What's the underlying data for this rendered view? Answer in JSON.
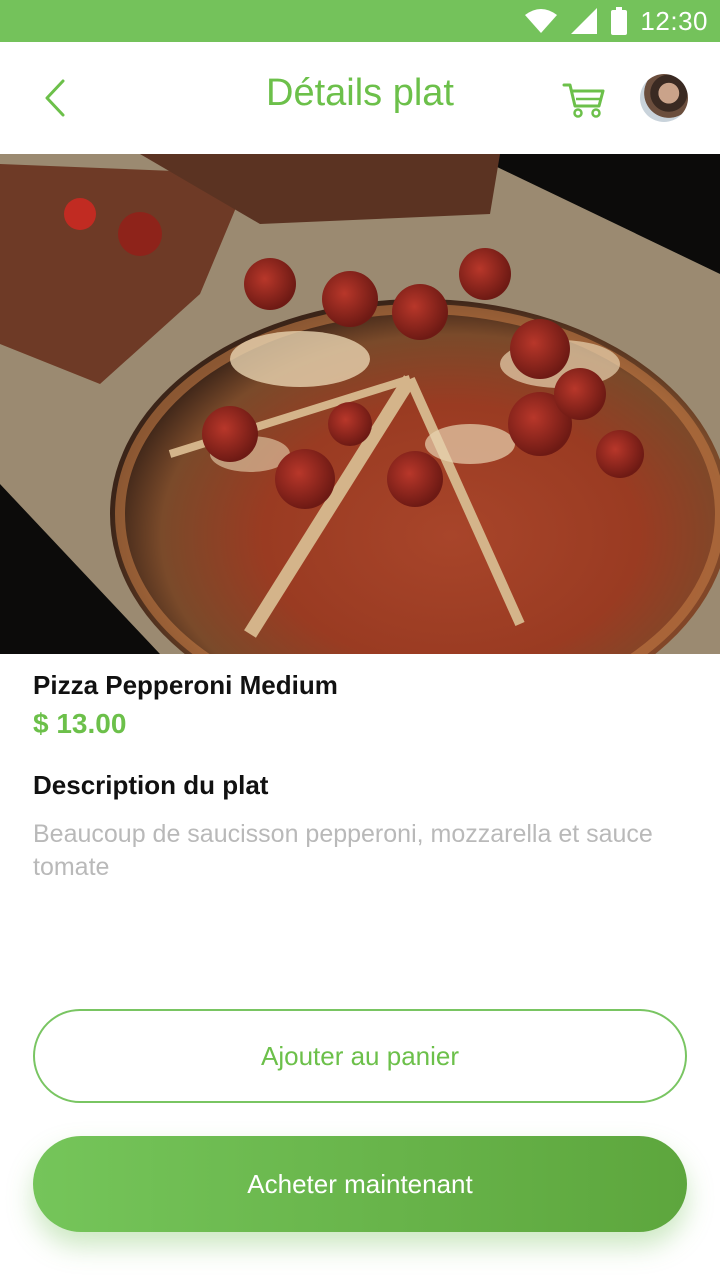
{
  "status_bar": {
    "time": "12:30"
  },
  "header": {
    "title": "Détails plat"
  },
  "product": {
    "name": "Pizza Pepperoni Medium",
    "price": "$ 13.00",
    "description_title": "Description du plat",
    "description": "Beaucoup de saucisson pepperoni, mozzarella et sauce tomate"
  },
  "actions": {
    "add_to_cart": "Ajouter au panier",
    "buy_now": "Acheter maintenant"
  },
  "icons": {
    "back": "chevron-left-icon",
    "cart": "shopping-cart-icon",
    "wifi": "wifi-icon",
    "signal": "signal-icon",
    "battery": "battery-icon"
  },
  "colors": {
    "brand": "#74c25b",
    "text": "#111111",
    "muted": "#b9b9b9"
  }
}
